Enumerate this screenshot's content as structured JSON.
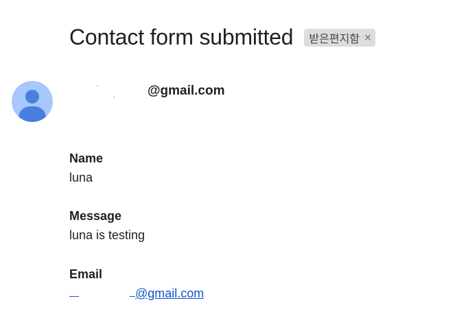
{
  "email": {
    "subject": "Contact form submitted",
    "label_chip": {
      "text": "받은편지함",
      "close_symbol": "×"
    },
    "sender": {
      "avatar_icon": "person-avatar-icon",
      "email_suffix": "@gmail.com"
    },
    "fields": [
      {
        "label": "Name",
        "value": "luna"
      },
      {
        "label": "Message",
        "value": "luna is testing"
      },
      {
        "label": "Email",
        "value": "@gmail.com"
      }
    ]
  },
  "colors": {
    "avatar_background": "#a8c7fa",
    "avatar_figure": "#4a7fe0",
    "link": "#1155cc",
    "chip_background": "#dddddd"
  }
}
